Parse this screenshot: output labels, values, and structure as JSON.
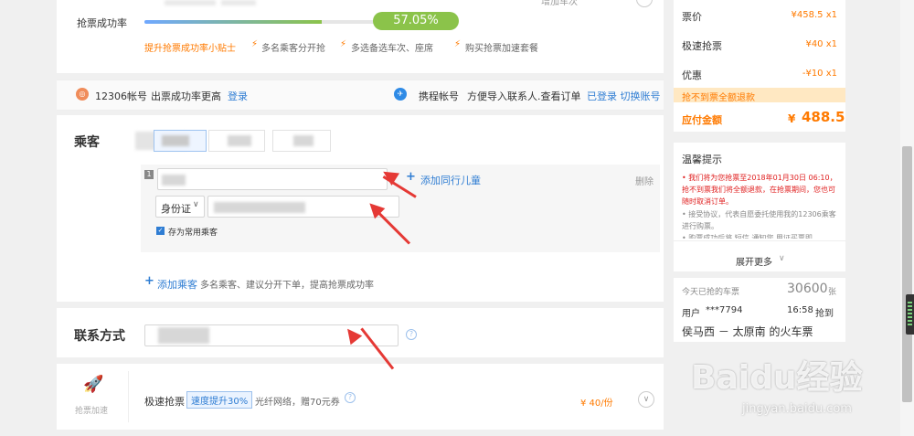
{
  "top": {
    "success_label": "抢票成功率",
    "success_value": "57.05%",
    "success_fraction": 0.5705,
    "tip_link": "提升抢票成功率小贴士",
    "tips": [
      "多名乘客分开抢",
      "多选备选车次、座席",
      "购买抢票加速套餐"
    ],
    "top_right_text": "增加车次"
  },
  "accounts": {
    "account_12306_label": "12306帐号",
    "account_12306_desc": "出票成功率更高",
    "login_link": "登录",
    "ctrip_label": "携程帐号",
    "ctrip_desc": "方便导入联系人.查看订单",
    "ctrip_status": "已登录 切换账号"
  },
  "passenger": {
    "title": "乘客",
    "row_number": "1",
    "add_child_link": "添加同行儿童",
    "delete_link": "删除",
    "id_type": "身份证",
    "save_checkbox_label": "存为常用乘客",
    "add_passenger_link": "添加乘客",
    "add_passenger_hint": "多名乘客、建议分开下单，提高抢票成功率"
  },
  "contact": {
    "title": "联系方式"
  },
  "speedup": {
    "icon_label": "抢票加速",
    "item_label": "极速抢票",
    "badge": "速度提升30%",
    "desc": "光纤网络，赠70元券",
    "price": "¥ 40/份"
  },
  "sidebar": {
    "rows": [
      {
        "label": "票价",
        "value": "¥458.5 x1"
      },
      {
        "label": "极速抢票",
        "value": "¥40 x1"
      },
      {
        "label": "优惠",
        "value": "-¥10 x1"
      }
    ],
    "refund_banner": "抢不到票全额退款",
    "total_label": "应付金额",
    "total_currency": "¥",
    "total_value": "488.5",
    "notice_title": "温馨提示",
    "notice_red": "• 我们将为您抢票至2018年01月30日 06:10，抢不到票我们将全额退款，在抢票期间，您也可随时取消订单。",
    "notice_gray": "• 接受协议，代表自愿委托使用我的12306乘客进行购票。",
    "notice_gray2": "• 购票成功后将 短信 通知您 用证买票即",
    "expand_more": "展开更多",
    "stats_label": "今天已抢的车票",
    "stats_count": "30600",
    "stats_unit": "张",
    "user_label": "用户",
    "user_name": "***7794",
    "user_time": "16:58",
    "user_action": "抢到",
    "route": "侯马西 － 太原南 的火车票"
  },
  "watermark": {
    "brand": "Baidu经验",
    "url": "jingyan.baidu.com"
  },
  "colors": {
    "accent_blue": "#2f7dd3",
    "accent_orange": "#ff7a00",
    "progress_green": "#8bc34a",
    "arrow_red": "#e53935"
  }
}
